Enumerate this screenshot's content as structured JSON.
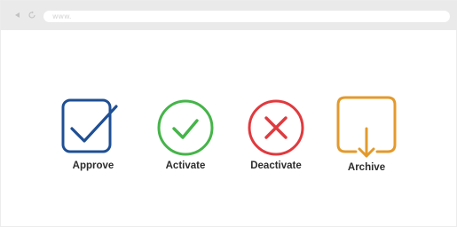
{
  "browser": {
    "address_placeholder": "www."
  },
  "actions": [
    {
      "label": "Approve",
      "icon": "checkbox-icon",
      "color": "#1f4f94"
    },
    {
      "label": "Activate",
      "icon": "check-circle-icon",
      "color": "#46b44a"
    },
    {
      "label": "Deactivate",
      "icon": "x-circle-icon",
      "color": "#e03a3e"
    },
    {
      "label": "Archive",
      "icon": "download-box-icon",
      "color": "#e39a2c"
    }
  ]
}
